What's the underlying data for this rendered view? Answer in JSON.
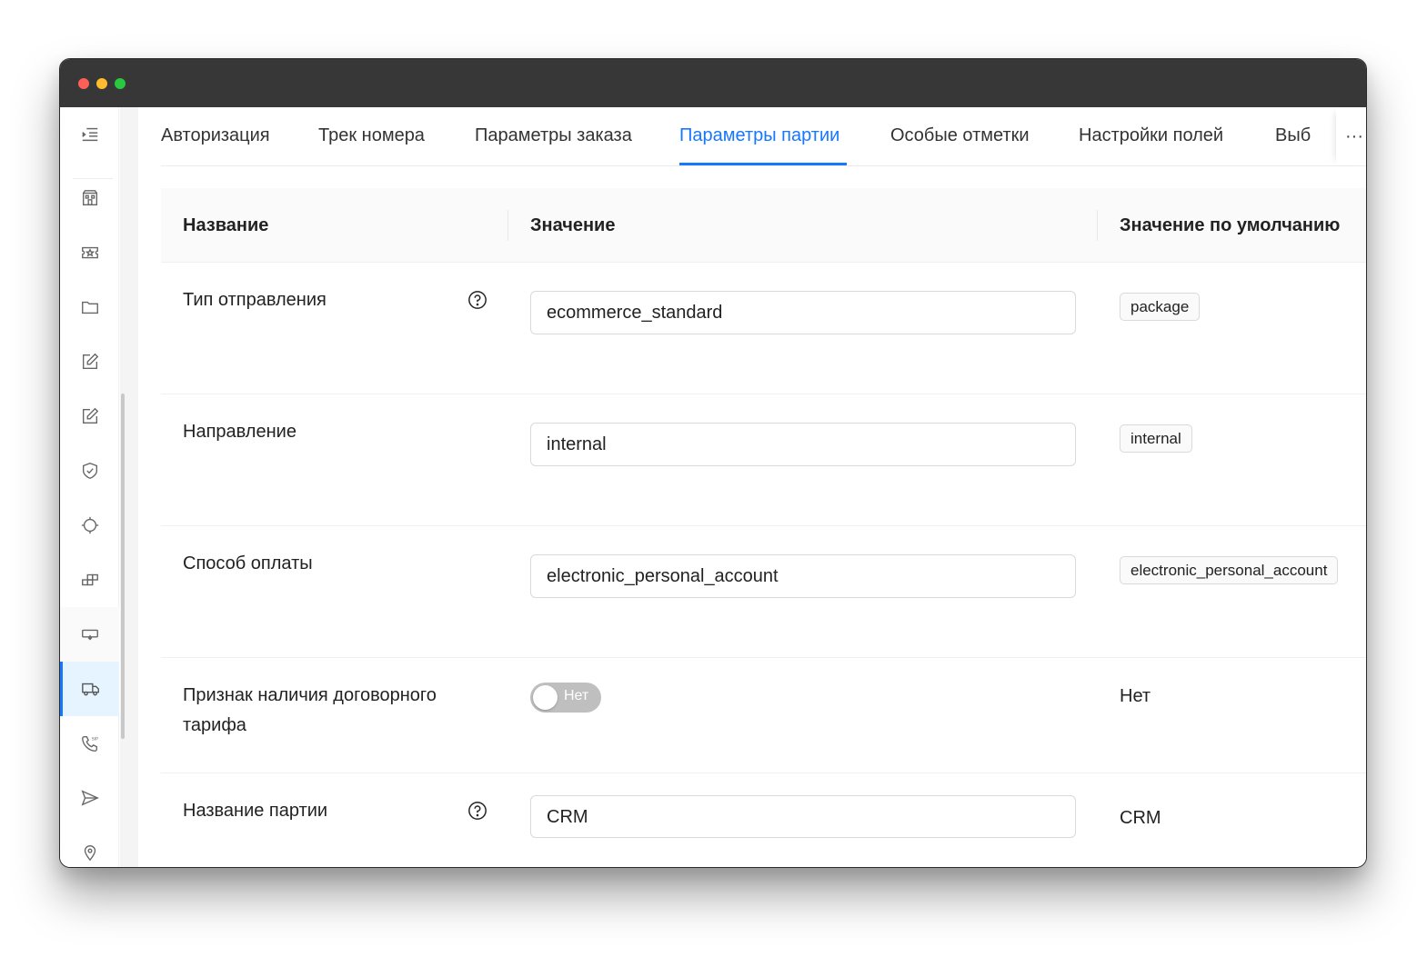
{
  "sidebar": {
    "items": [
      {
        "icon": "menu-collapse-icon"
      },
      {
        "icon": "building-icon"
      },
      {
        "icon": "ticket-star-icon"
      },
      {
        "icon": "folder-icon"
      },
      {
        "icon": "edit-icon"
      },
      {
        "icon": "edit-icon"
      },
      {
        "icon": "shield-check-icon"
      },
      {
        "icon": "target-icon"
      },
      {
        "icon": "blocks-icon"
      },
      {
        "icon": "keyboard-icon"
      },
      {
        "icon": "truck-icon"
      },
      {
        "icon": "sip-phone-icon"
      },
      {
        "icon": "send-icon"
      },
      {
        "icon": "location-pin-icon"
      }
    ],
    "active_icon": "truck-icon"
  },
  "tabs": {
    "items": [
      "Авторизация",
      "Трек номера",
      "Параметры заказа",
      "Параметры партии",
      "Особые отметки",
      "Настройки полей",
      "Выб"
    ],
    "active": "Параметры партии",
    "more": "···"
  },
  "table": {
    "headers": {
      "name": "Название",
      "value": "Значение",
      "default": "Значение по умолчанию"
    },
    "rows": [
      {
        "name": "Тип отправления",
        "value": "ecommerce_standard",
        "default": "package"
      },
      {
        "name": "Направление",
        "value": "internal",
        "default": "internal"
      },
      {
        "name": "Способ оплаты",
        "value": "electronic_personal_account",
        "default": "electronic_personal_account"
      },
      {
        "name": "Признак наличия договорного тарифа",
        "switch_label": "Нет",
        "switch_on": false,
        "default": "Нет"
      },
      {
        "name": "Название партии",
        "value": "CRM",
        "default": "CRM"
      }
    ]
  },
  "colors": {
    "accent": "#1677ff",
    "titlebar": "#373737",
    "switch_off": "#bfbfbf"
  }
}
